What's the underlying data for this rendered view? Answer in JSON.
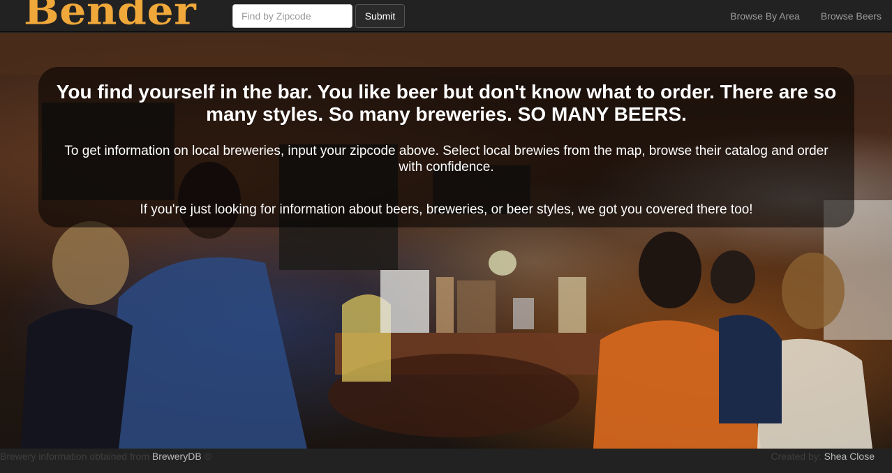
{
  "navbar": {
    "brand": "Bender",
    "zip_placeholder": "Find by Zipcode",
    "submit_label": "Submit",
    "links": [
      "Browse By Area",
      "Browse Beers"
    ]
  },
  "hero": {
    "headline": "You find yourself in the bar. You like beer but don't know what to order. There are so many styles. So many breweries. SO MANY BEERS.",
    "paragraph1": "To get information on local breweries, input your zipcode above. Select local brewies from the map, browse their catalog and order with confidence.",
    "paragraph2": "If you're just looking for information about beers, breweries, or beer styles, we got you covered there too!",
    "background_image": "crowded bar interior photo"
  },
  "footer": {
    "left_text": "Brewery information obtained from ",
    "left_link": "BreweryDB",
    "left_suffix": " ©",
    "right_text": "Created by: ",
    "right_link": "Shea Close"
  },
  "colors": {
    "brand": "#f0a83a",
    "navbar_bg": "#222222",
    "nav_link": "#9d9d9d"
  }
}
